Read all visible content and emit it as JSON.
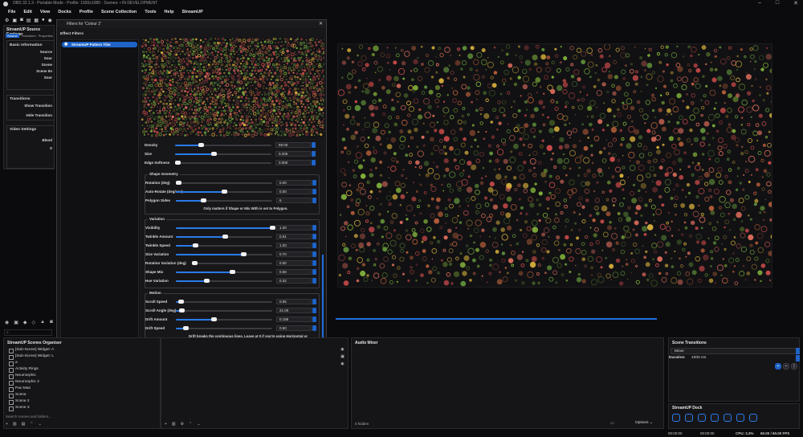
{
  "window": {
    "title": "OBS 32.1.3 - Portable Mode - Profile: 1920x1080 - Scenes: • IN DEVELOPMENT",
    "controls": [
      "–",
      "□",
      "✕"
    ]
  },
  "menu": [
    "File",
    "Edit",
    "View",
    "Docks",
    "Profile",
    "Scene Collection",
    "Tools",
    "Help",
    "StreamUP"
  ],
  "source_explorer": {
    "title": "StreamUP Source Explorer",
    "tabs": [
      "Source",
      "Transform",
      "Properties"
    ],
    "sections": [
      {
        "title": "Basic Information",
        "fields": [
          "Source",
          "Sour",
          "Scene",
          "Scene Ite",
          "Sour"
        ]
      },
      {
        "title": "Transitions",
        "fields": [
          "Show Transition",
          "Hide Transition"
        ]
      },
      {
        "title": "Video Settings",
        "fields": [
          "Blend",
          "S"
        ]
      }
    ]
  },
  "dialog": {
    "title": "Filters for 'Colour 2'",
    "effect_filters_label": "Effect Filters",
    "filter_item": "StreamUP Pattern Tiler",
    "defaults_button": "Defaults",
    "close_button": "Close",
    "credit": "obs-shaderfilter",
    "credit_version": " (2.6.0) by ",
    "credit_author": "Exeldro",
    "top_rows": [
      {
        "label": "Density",
        "value": "59.00",
        "pct": 0.27
      },
      {
        "label": "Size",
        "value": "0.205",
        "pct": 0.4
      },
      {
        "label": "Edge Softness",
        "value": "0.000",
        "pct": 0.0
      }
    ],
    "shape_geometry": {
      "title": "Shape Geometry",
      "rows": [
        {
          "label": "Rotation (deg)",
          "value": "0.00",
          "pct": 0.02
        },
        {
          "label": "Auto-Rotate (deg/sec)",
          "value": "0.00",
          "pct": 0.5
        },
        {
          "label": "Polygon Sides",
          "value": "6",
          "pct": 0.28
        }
      ],
      "note": "Only matters if Shape or Mix With is set to Polygon."
    },
    "variation": {
      "title": "Variation",
      "rows": [
        {
          "label": "Visibility",
          "value": "1.00",
          "pct": 1.0
        },
        {
          "label": "Twinkle Amount",
          "value": "0.51",
          "pct": 0.51
        },
        {
          "label": "Twinkle Speed",
          "value": "1.00",
          "pct": 0.2
        },
        {
          "label": "Size Variation",
          "value": "0.70",
          "pct": 0.7
        },
        {
          "label": "Rotation Variation (deg)",
          "value": "0.00",
          "pct": 0.0
        },
        {
          "label": "Shape Mix",
          "value": "0.58",
          "pct": 0.58
        },
        {
          "label": "Hue Variation",
          "value": "0.32",
          "pct": 0.32
        }
      ]
    },
    "motion": {
      "title": "Motion",
      "rows": [
        {
          "label": "Scroll Speed",
          "value": "0.55",
          "pct": 0.05
        },
        {
          "label": "Scroll Angle (deg)",
          "value": "21.00",
          "pct": 0.06
        },
        {
          "label": "Drift Amount",
          "value": "0.195",
          "pct": 0.39
        },
        {
          "label": "Drift Speed",
          "value": "0.50",
          "pct": 0.1
        }
      ],
      "note1": "Drift breaks the continuous lines. Leave at 0 if you're using Horizontal or",
      "note2": "Vertical Line.",
      "rows2": [
        {
          "label": "Pulse Amount",
          "value": "0.00",
          "pct": 0.0
        },
        {
          "label": "Pulse Speed",
          "value": "1.00",
          "pct": 0.2
        }
      ]
    }
  },
  "scenes": {
    "title": "StreamUP Scenes Organiser",
    "items": [
      "[Sub-Scene] Widget: A",
      "[Sub-Scene] Widget: L",
      "a",
      "Activity Rings",
      "Neumorphic",
      "Neumorphic 2",
      "Pac-Man",
      "Scene",
      "Scene 2",
      "Scene 3"
    ],
    "search_placeholder": "Search scenes and folders..."
  },
  "audio_mixer": {
    "title": "Audio Mixer",
    "hidden": "0 hidden",
    "options": "Options"
  },
  "scene_transitions": {
    "title": "Scene Transitions",
    "transition": "Move",
    "duration_label": "Duration",
    "duration_value": "1000 ms"
  },
  "streamup_dock": {
    "title": "StreamUP Dock"
  },
  "status": {
    "cpu": "CPU: 3.3%",
    "fps": "60.00 / 60.00 FPS",
    "time1": "00:00:00",
    "time2": "00:00:00"
  },
  "colors": {
    "accent": "#1f6fe0",
    "bg": "#0b0b0d",
    "panel": "#151518"
  }
}
